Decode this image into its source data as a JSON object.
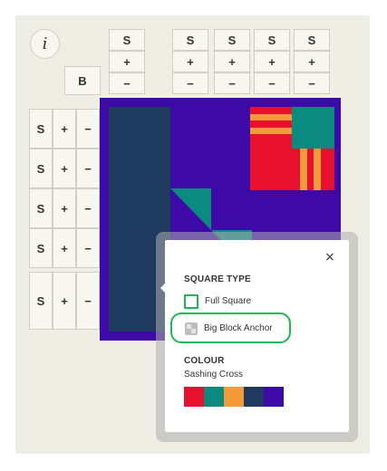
{
  "info_button": {
    "label": "i"
  },
  "b_button": {
    "label": "B"
  },
  "column_controls": [
    {
      "s": "S",
      "plus": "+",
      "minus": "−"
    },
    {
      "s": "S",
      "plus": "+",
      "minus": "−"
    },
    {
      "s": "S",
      "plus": "+",
      "minus": "−"
    },
    {
      "s": "S",
      "plus": "+",
      "minus": "−"
    },
    {
      "s": "S",
      "plus": "+",
      "minus": "−"
    }
  ],
  "row_controls": [
    {
      "s": "S",
      "plus": "+",
      "minus": "−"
    },
    {
      "s": "S",
      "plus": "+",
      "minus": "−"
    },
    {
      "s": "S",
      "plus": "+",
      "minus": "−"
    },
    {
      "s": "S",
      "plus": "+",
      "minus": "−"
    },
    {
      "s": "S",
      "plus": "+",
      "minus": "−"
    }
  ],
  "popup": {
    "close": "×",
    "square_type_heading": "SQUARE TYPE",
    "options": [
      {
        "label": "Full Square",
        "icon": "full-square-icon"
      },
      {
        "label": "Big Block Anchor",
        "icon": "big-block-anchor-icon",
        "highlighted": true
      }
    ],
    "colour_heading": "COLOUR",
    "colour_name": "Sashing Cross",
    "palette": [
      "#e8112d",
      "#0b8a80",
      "#f39a3a",
      "#1e3a5f",
      "#3d0aa8"
    ]
  },
  "colors": {
    "panel": "#eeeee4",
    "quilt_purple": "#3d0aa8",
    "navy": "#1e3a5f",
    "teal": "#0b8a80",
    "red": "#e8112d",
    "orange": "#f39a3a",
    "highlight": "#1db954"
  }
}
